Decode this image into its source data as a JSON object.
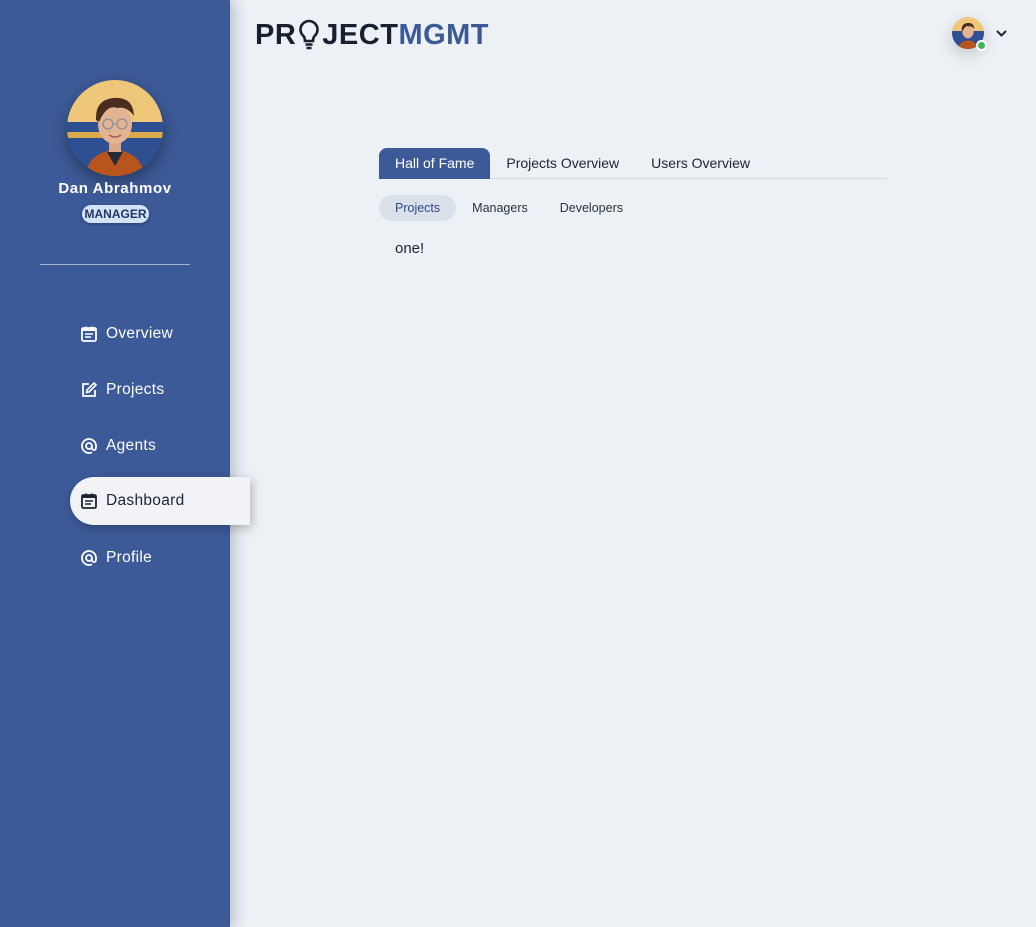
{
  "brand": {
    "logo_prefix": "PR",
    "logo_middle": "JECT",
    "logo_accent": "MGMT"
  },
  "user": {
    "name": "Dan Abrahmov",
    "role": "MANAGER",
    "status": "online"
  },
  "sidebar": {
    "items": [
      {
        "label": "Overview",
        "icon": "calendar-icon",
        "active": false
      },
      {
        "label": "Projects",
        "icon": "edit-icon",
        "active": false
      },
      {
        "label": "Agents",
        "icon": "at-sign-icon",
        "active": false
      },
      {
        "label": "Dashboard",
        "icon": "calendar-icon",
        "active": true
      },
      {
        "label": "Profile",
        "icon": "at-sign-icon",
        "active": false
      }
    ]
  },
  "header": {
    "menu_icon": "chevron-down-icon"
  },
  "main": {
    "tabs": [
      {
        "label": "Hall of Fame",
        "active": true
      },
      {
        "label": "Projects Overview",
        "active": false
      },
      {
        "label": "Users Overview",
        "active": false
      }
    ],
    "subtabs": [
      {
        "label": "Projects",
        "active": true
      },
      {
        "label": "Managers",
        "active": false
      },
      {
        "label": "Developers",
        "active": false
      }
    ],
    "content_text": "one!"
  },
  "colors": {
    "sidebar_bg": "#3c5a97",
    "accent": "#3c5a97",
    "page_bg": "#edf1f6",
    "badge_bg": "#d3e3f5",
    "online": "#3fb55a"
  }
}
